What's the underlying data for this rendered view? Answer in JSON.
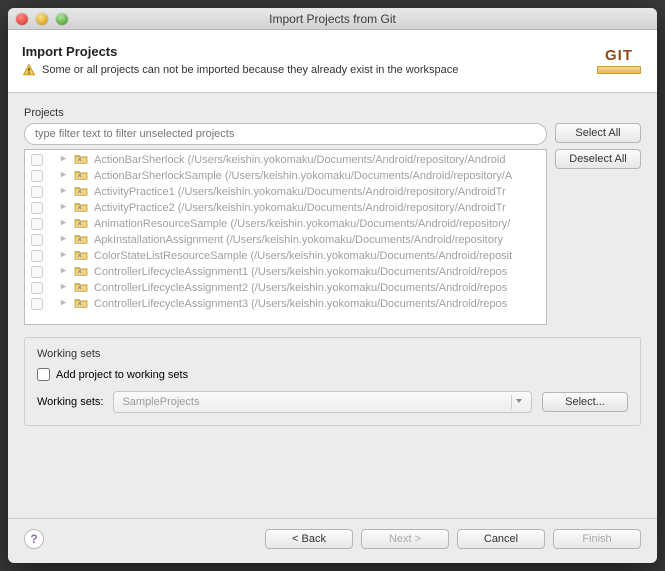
{
  "window": {
    "title": "Import Projects from Git"
  },
  "header": {
    "title": "Import Projects",
    "message": "Some or all projects can not be imported because they already exist in the workspace",
    "logo_text": "GIT"
  },
  "projects": {
    "label": "Projects",
    "filter_placeholder": "type filter text to filter unselected projects",
    "items": [
      {
        "name": "ActionBarSherlock",
        "path": "(/Users/keishin.yokomaku/Documents/Android/repository/Android"
      },
      {
        "name": "ActionBarSherlockSample",
        "path": "(/Users/keishin.yokomaku/Documents/Android/repository/A"
      },
      {
        "name": "ActivityPractice1",
        "path": "(/Users/keishin.yokomaku/Documents/Android/repository/AndroidTr"
      },
      {
        "name": "ActivityPractice2",
        "path": "(/Users/keishin.yokomaku/Documents/Android/repository/AndroidTr"
      },
      {
        "name": "AnimationResourceSample",
        "path": "(/Users/keishin.yokomaku/Documents/Android/repository/"
      },
      {
        "name": "ApkInstallationAssignment",
        "path": "(/Users/keishin.yokomaku/Documents/Android/repository"
      },
      {
        "name": "ColorStateListResourceSample",
        "path": "(/Users/keishin.yokomaku/Documents/Android/reposit"
      },
      {
        "name": "ControllerLifecycleAssignment1",
        "path": "(/Users/keishin.yokomaku/Documents/Android/repos"
      },
      {
        "name": "ControllerLifecycleAssignment2",
        "path": "(/Users/keishin.yokomaku/Documents/Android/repos"
      },
      {
        "name": "ControllerLifecycleAssignment3",
        "path": "(/Users/keishin.yokomaku/Documents/Android/repos"
      }
    ],
    "select_all": "Select All",
    "deselect_all": "Deselect All"
  },
  "working_sets": {
    "title": "Working sets",
    "checkbox_label": "Add project to working sets",
    "label": "Working sets:",
    "combo_value": "SampleProjects",
    "select_button": "Select..."
  },
  "footer": {
    "back": "< Back",
    "next": "Next >",
    "cancel": "Cancel",
    "finish": "Finish"
  }
}
